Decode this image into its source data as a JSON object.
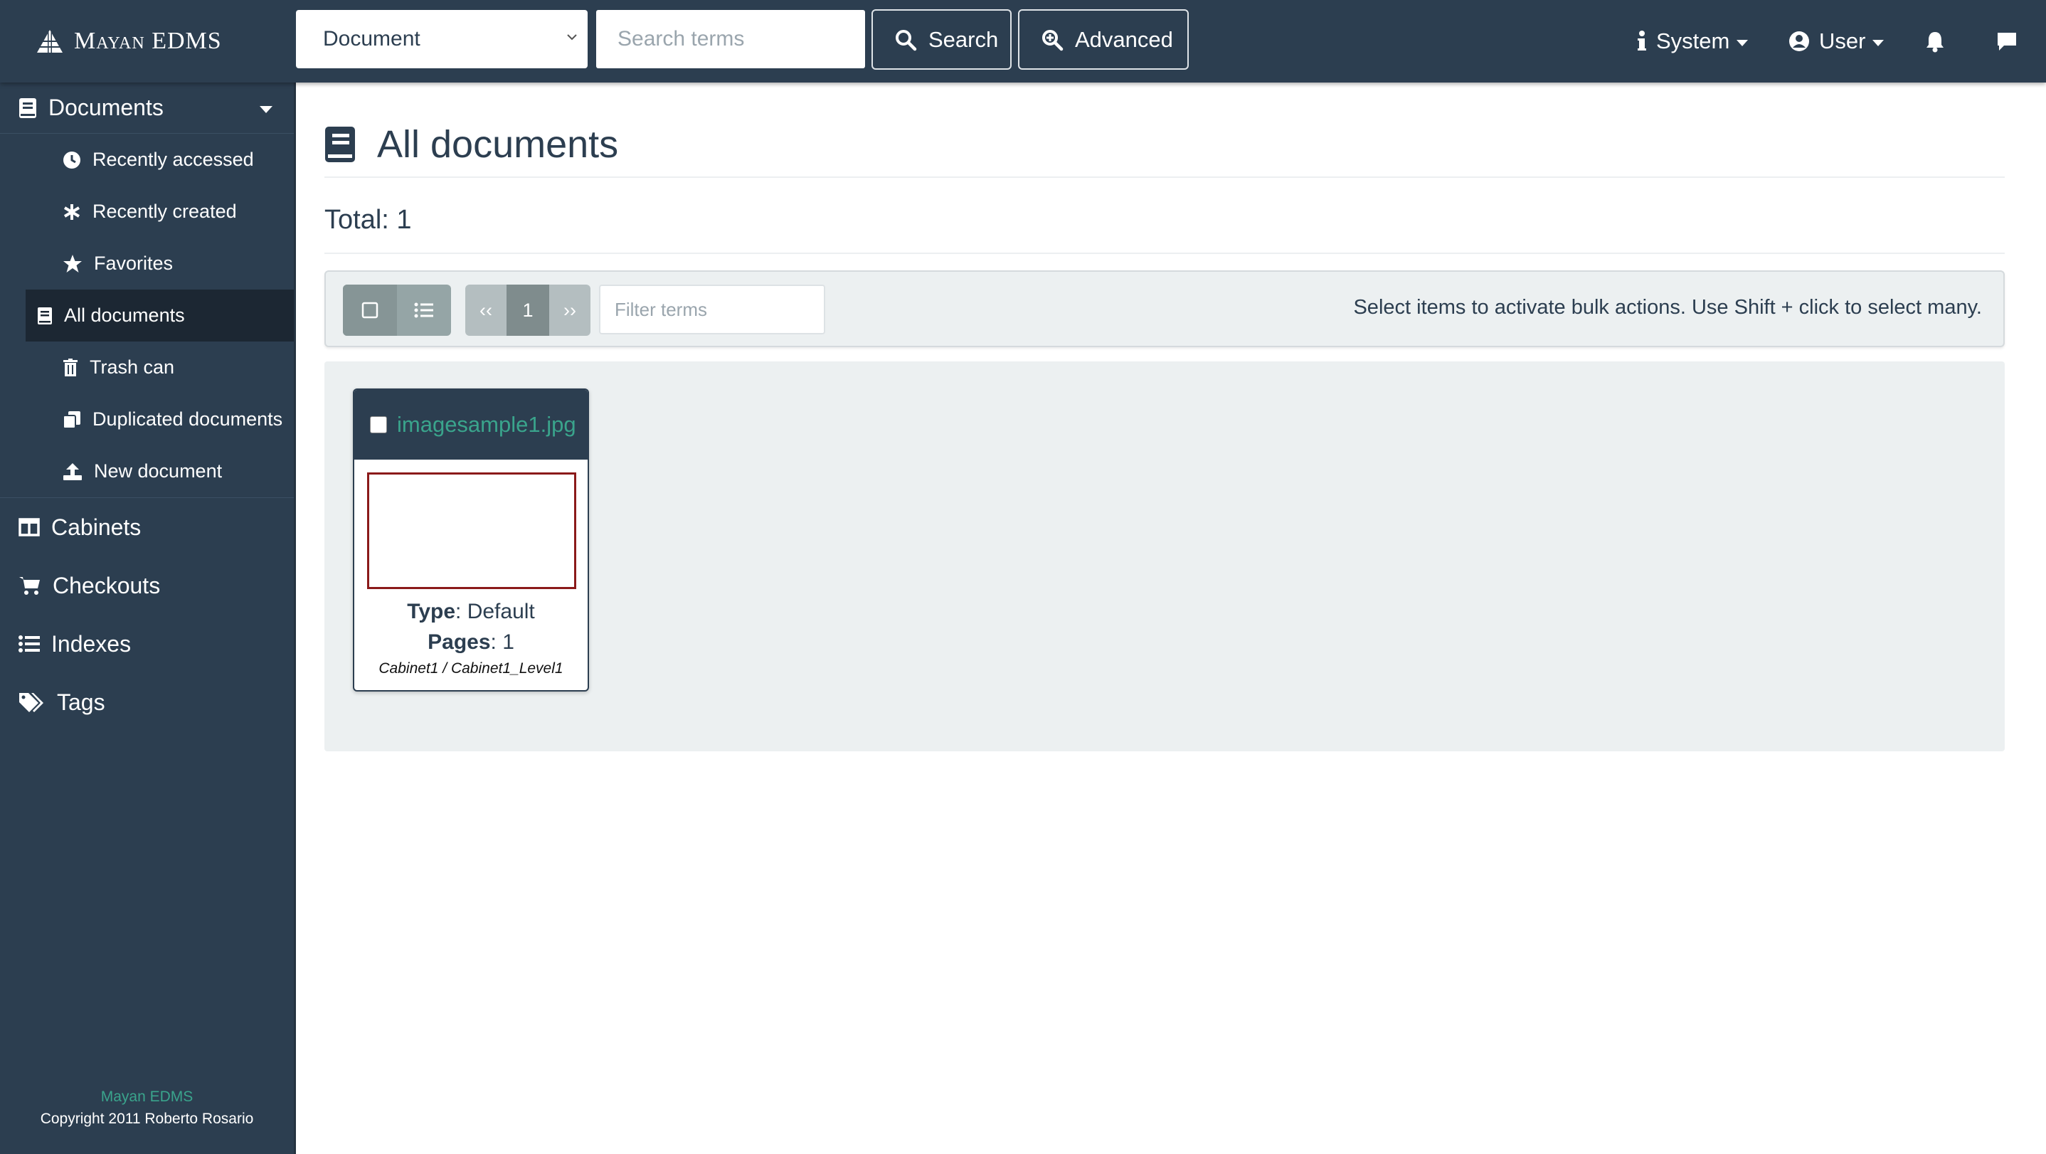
{
  "app": {
    "brand": "Mayan EDMS"
  },
  "header": {
    "search_type": "Document",
    "search_placeholder": "Search terms",
    "search_button": "Search",
    "advanced_button": "Advanced",
    "system_menu": "System",
    "user_menu": "User"
  },
  "sidebar": {
    "documents_label": "Documents",
    "items": [
      {
        "label": "Recently accessed",
        "icon": "clock-icon"
      },
      {
        "label": "Recently created",
        "icon": "asterisk-icon"
      },
      {
        "label": "Favorites",
        "icon": "star-icon"
      },
      {
        "label": "All documents",
        "icon": "book-icon",
        "active": true
      },
      {
        "label": "Trash can",
        "icon": "trash-icon"
      },
      {
        "label": "Duplicated documents",
        "icon": "copy-icon"
      },
      {
        "label": "New document",
        "icon": "upload-icon"
      }
    ],
    "categories": [
      {
        "label": "Cabinets",
        "icon": "columns-icon"
      },
      {
        "label": "Checkouts",
        "icon": "cart-icon"
      },
      {
        "label": "Indexes",
        "icon": "list-icon"
      },
      {
        "label": "Tags",
        "icon": "tags-icon"
      }
    ],
    "footer_app": "Mayan EDMS",
    "footer_copyright": "Copyright 2011 Roberto Rosario"
  },
  "main": {
    "title": "All documents",
    "total": "Total: 1",
    "pager": {
      "prev": "‹‹",
      "current": "1",
      "next": "››"
    },
    "filter_placeholder": "Filter terms",
    "bulk_message": "Select items to activate bulk actions. Use Shift + click to select many.",
    "documents": [
      {
        "name": "imagesample1.jpg",
        "type_label": "Type",
        "type_value": "Default",
        "pages_label": "Pages",
        "pages_value": "1",
        "cabinets": "Cabinet1 / Cabinet1_Level1"
      }
    ]
  },
  "colors": {
    "navy": "#2c3e50",
    "accent": "#3aa48c",
    "panel": "#ecf0f1"
  }
}
